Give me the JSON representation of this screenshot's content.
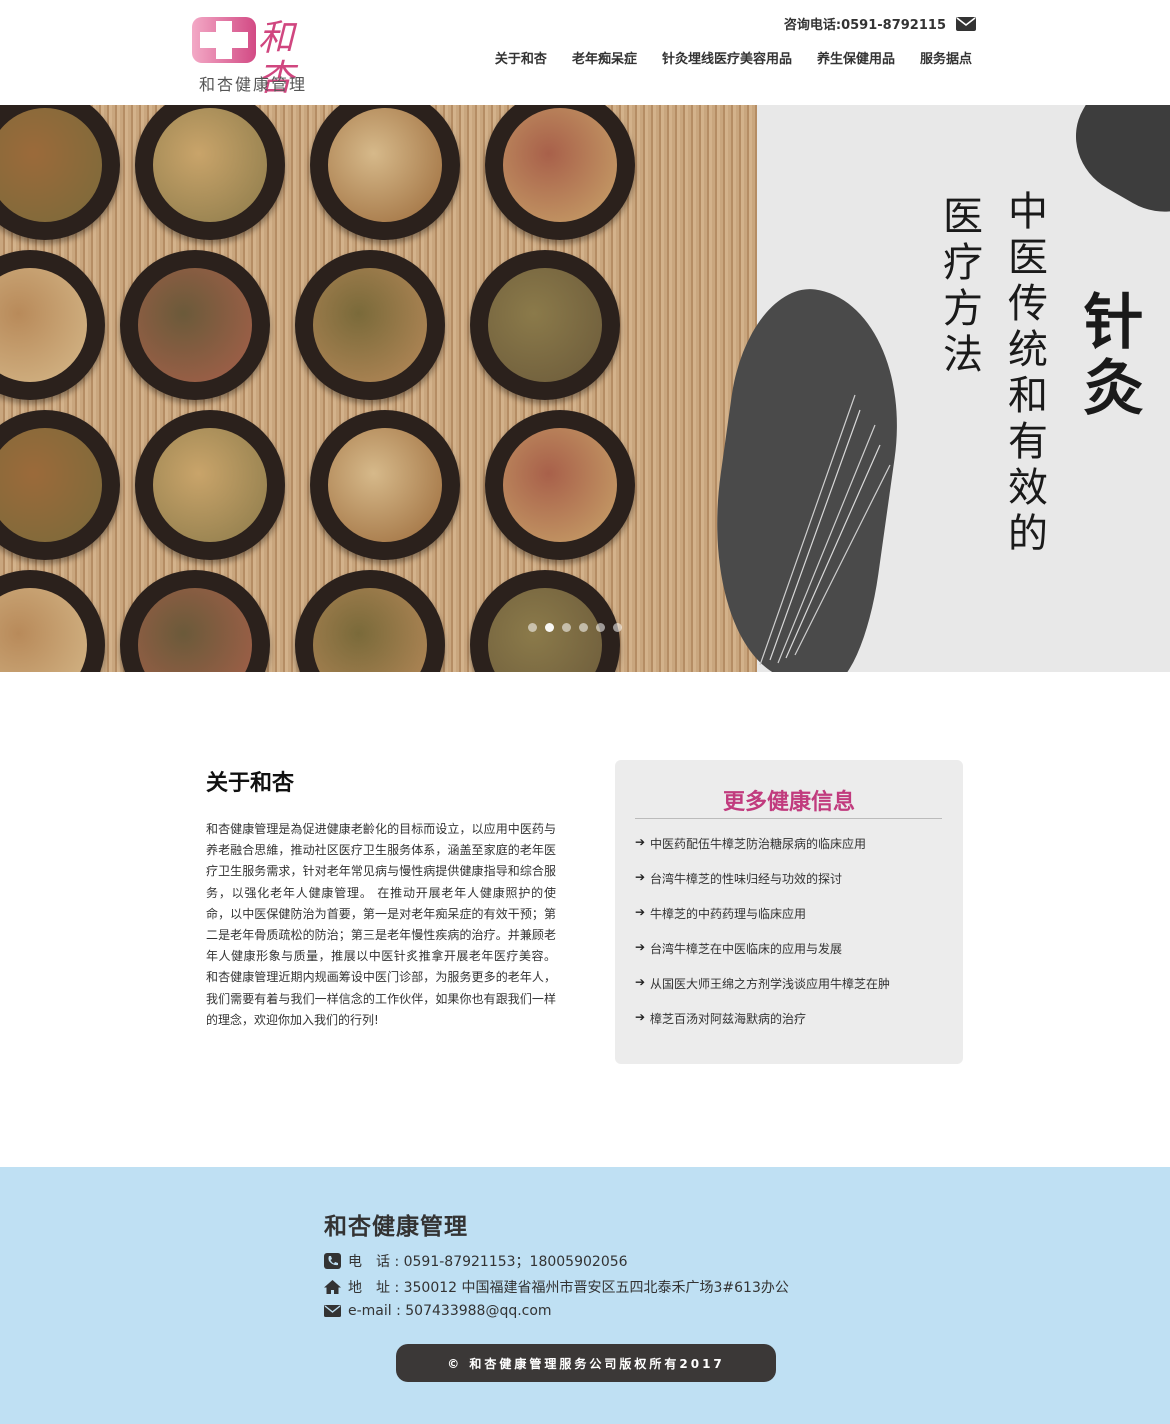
{
  "header": {
    "logo_script": "和杏",
    "logo_text": "和杏健康管理",
    "phone_label": "咨询电话:0591-8792115",
    "mail_icon": "envelope-icon",
    "nav": [
      "关于和杏",
      "老年痴呆症",
      "针灸埋线医疗美容用品",
      "养生保健用品",
      "服务据点"
    ]
  },
  "hero": {
    "calligraphy_col1": "针灸",
    "calligraphy_col2": "中医传统和有效的",
    "calligraphy_col3": "医疗方法",
    "slide_count": 6,
    "active_slide": 1
  },
  "about": {
    "title": "关于和杏",
    "body": "和杏健康管理是為促进健康老齡化的目标而设立，以应用中医药与养老融合思維，推动社区医疗卫生服务体系，涵盖至家庭的老年医疗卫生服务需求，针对老年常见病与慢性病提供健康指导和综合服务，以强化老年人健康管理。 在推动开展老年人健康照护的使命，以中医保健防治为首要，第一是对老年痴呆症的有效干预；第二是老年骨质疏松的防治；第三是老年慢性疾病的治疗。并兼顾老年人健康形象与质量，推展以中医针炙推拿开展老年医疗美容。 和杏健康管理近期内规画筹设中医门诊部，为服务更多的老年人，我们需要有着与我们一样信念的工作伙伴，如果你也有跟我们一样的理念，欢迎你加入我们的行列!"
  },
  "info": {
    "title": "更多健康信息",
    "items": [
      "中医药配伍牛樟芝防治糖尿病的临床应用",
      "台湾牛樟芝的性味归经与功效的探讨",
      "牛樟芝的中药药理与临床应用",
      "台湾牛樟芝在中医临床的应用与发展",
      "从国医大师王绵之方剂学浅谈应用牛樟芝在肿",
      "樟芝百汤对阿兹海默病的治疗"
    ]
  },
  "footer": {
    "title": "和杏健康管理",
    "phone": "电　话 : 0591-87921153；18005902056",
    "address": "地　址 : 350012 中国福建省福州市晋安区五四北泰禾广场3#613办公",
    "email": "e-mail : 507433988@qq.com",
    "copyright": "© 和杏健康管理服务公司版权所有2017"
  },
  "colors": {
    "brand_pink": "#c13b7e",
    "footer_bg": "#bfe0f3",
    "info_bg": "#ececec",
    "copyright_bg": "#3b3837"
  }
}
